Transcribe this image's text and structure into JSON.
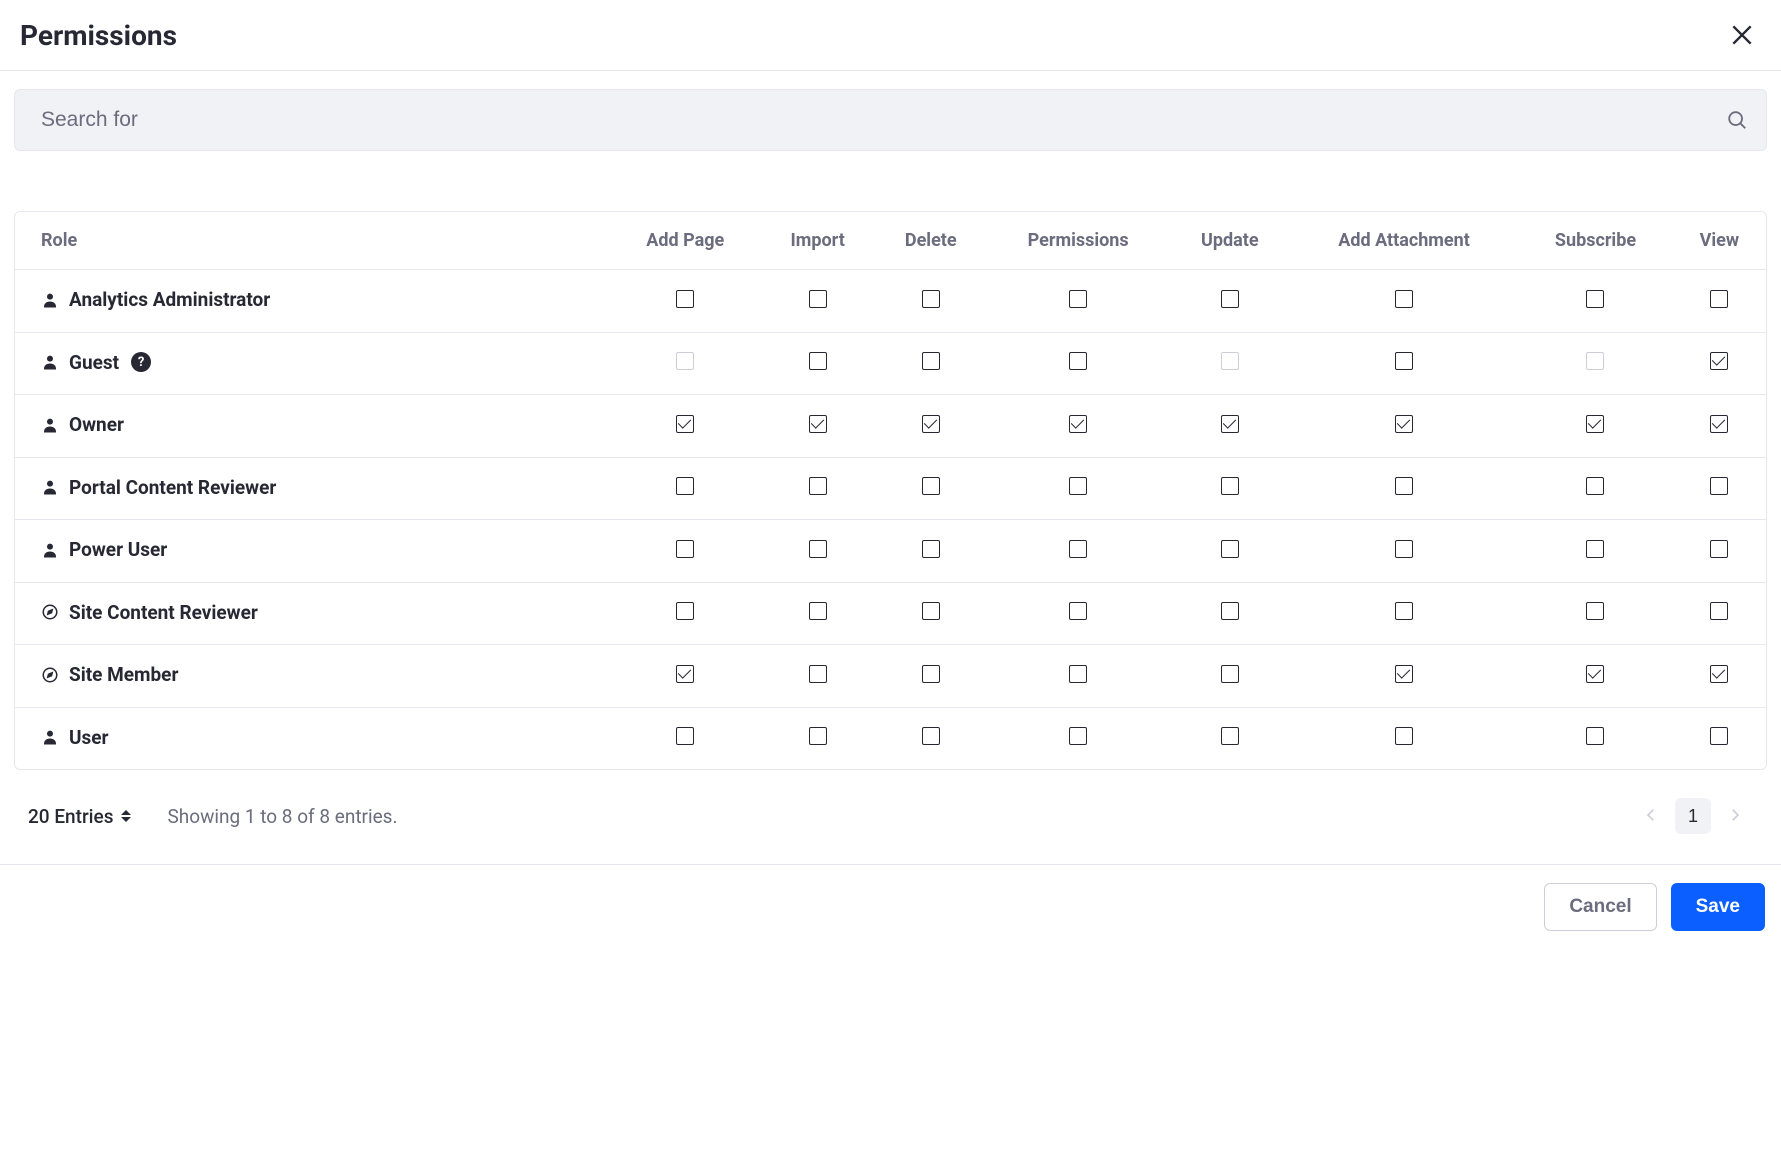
{
  "header": {
    "title": "Permissions"
  },
  "search": {
    "placeholder": "Search for"
  },
  "columns": [
    "Role",
    "Add Page",
    "Import",
    "Delete",
    "Permissions",
    "Update",
    "Add Attachment",
    "Subscribe",
    "View"
  ],
  "roles": [
    {
      "name": "Analytics Administrator",
      "icon": "user",
      "help": false,
      "perms": {
        "add_page": {
          "checked": false,
          "disabled": false
        },
        "import": {
          "checked": false,
          "disabled": false
        },
        "delete": {
          "checked": false,
          "disabled": false
        },
        "permissions": {
          "checked": false,
          "disabled": false
        },
        "update": {
          "checked": false,
          "disabled": false
        },
        "add_attachment": {
          "checked": false,
          "disabled": false
        },
        "subscribe": {
          "checked": false,
          "disabled": false
        },
        "view": {
          "checked": false,
          "disabled": false
        }
      }
    },
    {
      "name": "Guest",
      "icon": "user",
      "help": true,
      "perms": {
        "add_page": {
          "checked": false,
          "disabled": true
        },
        "import": {
          "checked": false,
          "disabled": false
        },
        "delete": {
          "checked": false,
          "disabled": false
        },
        "permissions": {
          "checked": false,
          "disabled": false
        },
        "update": {
          "checked": false,
          "disabled": true
        },
        "add_attachment": {
          "checked": false,
          "disabled": false
        },
        "subscribe": {
          "checked": false,
          "disabled": true
        },
        "view": {
          "checked": true,
          "disabled": false
        }
      }
    },
    {
      "name": "Owner",
      "icon": "user",
      "help": false,
      "perms": {
        "add_page": {
          "checked": true,
          "disabled": false
        },
        "import": {
          "checked": true,
          "disabled": false
        },
        "delete": {
          "checked": true,
          "disabled": false
        },
        "permissions": {
          "checked": true,
          "disabled": false
        },
        "update": {
          "checked": true,
          "disabled": false
        },
        "add_attachment": {
          "checked": true,
          "disabled": false
        },
        "subscribe": {
          "checked": true,
          "disabled": false
        },
        "view": {
          "checked": true,
          "disabled": false
        }
      }
    },
    {
      "name": "Portal Content Reviewer",
      "icon": "user",
      "help": false,
      "perms": {
        "add_page": {
          "checked": false,
          "disabled": false
        },
        "import": {
          "checked": false,
          "disabled": false
        },
        "delete": {
          "checked": false,
          "disabled": false
        },
        "permissions": {
          "checked": false,
          "disabled": false
        },
        "update": {
          "checked": false,
          "disabled": false
        },
        "add_attachment": {
          "checked": false,
          "disabled": false
        },
        "subscribe": {
          "checked": false,
          "disabled": false
        },
        "view": {
          "checked": false,
          "disabled": false
        }
      }
    },
    {
      "name": "Power User",
      "icon": "user",
      "help": false,
      "perms": {
        "add_page": {
          "checked": false,
          "disabled": false
        },
        "import": {
          "checked": false,
          "disabled": false
        },
        "delete": {
          "checked": false,
          "disabled": false
        },
        "permissions": {
          "checked": false,
          "disabled": false
        },
        "update": {
          "checked": false,
          "disabled": false
        },
        "add_attachment": {
          "checked": false,
          "disabled": false
        },
        "subscribe": {
          "checked": false,
          "disabled": false
        },
        "view": {
          "checked": false,
          "disabled": false
        }
      }
    },
    {
      "name": "Site Content Reviewer",
      "icon": "compass",
      "help": false,
      "perms": {
        "add_page": {
          "checked": false,
          "disabled": false
        },
        "import": {
          "checked": false,
          "disabled": false
        },
        "delete": {
          "checked": false,
          "disabled": false
        },
        "permissions": {
          "checked": false,
          "disabled": false
        },
        "update": {
          "checked": false,
          "disabled": false
        },
        "add_attachment": {
          "checked": false,
          "disabled": false
        },
        "subscribe": {
          "checked": false,
          "disabled": false
        },
        "view": {
          "checked": false,
          "disabled": false
        }
      }
    },
    {
      "name": "Site Member",
      "icon": "compass",
      "help": false,
      "perms": {
        "add_page": {
          "checked": true,
          "disabled": false
        },
        "import": {
          "checked": false,
          "disabled": false
        },
        "delete": {
          "checked": false,
          "disabled": false
        },
        "permissions": {
          "checked": false,
          "disabled": false
        },
        "update": {
          "checked": false,
          "disabled": false
        },
        "add_attachment": {
          "checked": true,
          "disabled": false
        },
        "subscribe": {
          "checked": true,
          "disabled": false
        },
        "view": {
          "checked": true,
          "disabled": false
        }
      }
    },
    {
      "name": "User",
      "icon": "user",
      "help": false,
      "perms": {
        "add_page": {
          "checked": false,
          "disabled": false
        },
        "import": {
          "checked": false,
          "disabled": false
        },
        "delete": {
          "checked": false,
          "disabled": false
        },
        "permissions": {
          "checked": false,
          "disabled": false
        },
        "update": {
          "checked": false,
          "disabled": false
        },
        "add_attachment": {
          "checked": false,
          "disabled": false
        },
        "subscribe": {
          "checked": false,
          "disabled": false
        },
        "view": {
          "checked": false,
          "disabled": false
        }
      }
    }
  ],
  "perm_keys": [
    "add_page",
    "import",
    "delete",
    "permissions",
    "update",
    "add_attachment",
    "subscribe",
    "view"
  ],
  "pagination": {
    "entries_label": "20 Entries",
    "showing_text": "Showing 1 to 8 of 8 entries.",
    "current_page": "1"
  },
  "actions": {
    "cancel": "Cancel",
    "save": "Save"
  },
  "help_badge_text": "?"
}
